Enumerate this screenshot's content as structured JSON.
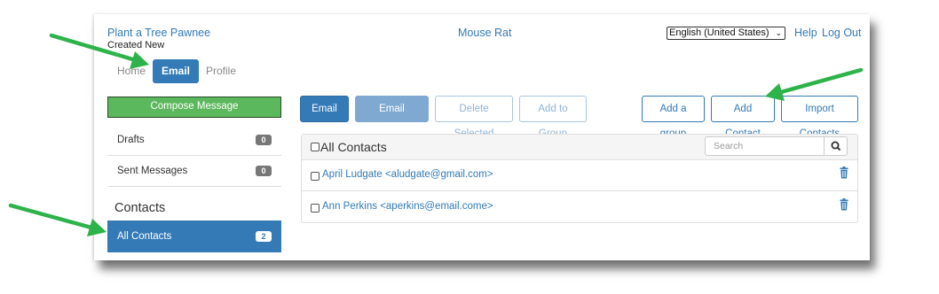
{
  "header": {
    "site_title": "Plant a Tree Pawnee",
    "subtitle": "Created New",
    "center_title": "Mouse Rat",
    "language": "English (United States)",
    "help_label": "Help",
    "logout_label": "Log Out"
  },
  "nav": {
    "home": "Home",
    "email": "Email",
    "profile": "Profile"
  },
  "sidebar": {
    "compose": "Compose Message",
    "drafts_label": "Drafts",
    "drafts_count": "0",
    "sent_label": "Sent Messages",
    "sent_count": "0",
    "contacts_heading": "Contacts",
    "all_contacts_label": "All Contacts",
    "all_contacts_count": "2"
  },
  "toolbar": {
    "email_all": "Email All",
    "email_selected": "Email Selected",
    "delete_selected": "Delete Selected",
    "add_to_group": "Add to Group",
    "add_group": "Add a group",
    "add_contact": "Add Contact",
    "import_contacts": "Import Contacts"
  },
  "contacts": {
    "title": "All Contacts",
    "search_placeholder": "Search",
    "rows": [
      {
        "text": "April Ludgate <aludgate@gmail.com>"
      },
      {
        "text": "Ann Perkins <aperkins@email.come>"
      }
    ]
  },
  "colors": {
    "primary": "#337ab7",
    "compose_green": "#5cb85c",
    "annotation_arrow": "#2db34a"
  }
}
